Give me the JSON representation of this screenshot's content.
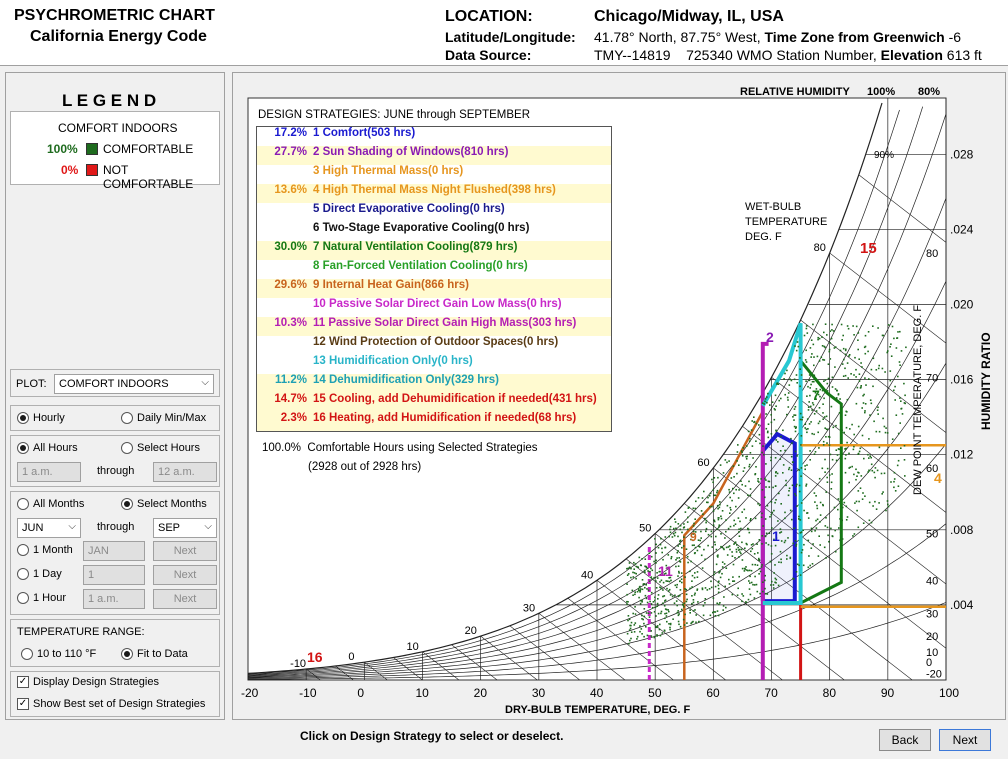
{
  "header": {
    "title_line1": "PSYCHROMETRIC CHART",
    "title_line2": "California Energy Code",
    "location_label": "LOCATION:",
    "location_value": "Chicago/Midway, IL, USA",
    "latlon_label": "Latitude/Longitude:",
    "latlon_value": "41.78° North, 87.75° West,",
    "timezone_label": "Time Zone from Greenwich",
    "timezone_value": "-6",
    "source_label": "Data Source:",
    "source_value": "TMY--14819",
    "wmo_value": "725340 WMO Station Number,",
    "elevation_label": "Elevation",
    "elevation_value": "613 ft"
  },
  "legend": {
    "title": "L E G E N D",
    "subtitle": "COMFORT INDOORS",
    "items": [
      {
        "pct": "100%",
        "label": "COMFORTABLE",
        "color": "#1e6b1e"
      },
      {
        "pct": "0%",
        "label": "NOT COMFORTABLE",
        "color": "#e01818"
      }
    ]
  },
  "controls": {
    "plot_label": "PLOT:",
    "plot_value": "COMFORT INDOORS",
    "hourly": "Hourly",
    "daily": "Daily Min/Max",
    "all_hours": "All Hours",
    "select_hours": "Select Hours",
    "hour_from": "1 a.m.",
    "through": "through",
    "hour_to": "12 a.m.",
    "all_months": "All Months",
    "select_months": "Select Months",
    "month_from": "JUN",
    "month_to": "SEP",
    "one_month": "1 Month",
    "one_month_val": "JAN",
    "one_day": "1 Day",
    "one_day_val": "1",
    "one_hour": "1 Hour",
    "one_hour_val": "1 a.m.",
    "next": "Next",
    "temp_range_label": "TEMPERATURE RANGE:",
    "range_a": "10 to 110 °F",
    "range_b": "Fit to Data",
    "display_strategies": "Display Design Strategies",
    "show_best": "Show Best set of Design Strategies"
  },
  "strategies": {
    "title": "DESIGN STRATEGIES:  JUNE through SEPTEMBER",
    "items": [
      {
        "pct": "17.2%",
        "label": "1  Comfort(503 hrs)",
        "color": "#1a1ad0",
        "hl": false
      },
      {
        "pct": "27.7%",
        "label": "2  Sun Shading of Windows(810 hrs)",
        "color": "#8a1ab4",
        "hl": true
      },
      {
        "pct": "",
        "label": "3  High Thermal Mass(0 hrs)",
        "color": "#e6961e",
        "hl": false
      },
      {
        "pct": "13.6%",
        "label": "4  High Thermal Mass Night Flushed(398 hrs)",
        "color": "#e6961e",
        "hl": true
      },
      {
        "pct": "",
        "label": "5  Direct Evaporative Cooling(0 hrs)",
        "color": "#1a1a8c",
        "hl": false
      },
      {
        "pct": "",
        "label": "6  Two-Stage Evaporative Cooling(0 hrs)",
        "color": "#111111",
        "hl": false
      },
      {
        "pct": "30.0%",
        "label": "7  Natural Ventilation Cooling(879 hrs)",
        "color": "#147814",
        "hl": true
      },
      {
        "pct": "",
        "label": "8  Fan-Forced Ventilation Cooling(0 hrs)",
        "color": "#28a028",
        "hl": false
      },
      {
        "pct": "29.6%",
        "label": "9  Internal Heat Gain(866 hrs)",
        "color": "#c8641e",
        "hl": true
      },
      {
        "pct": "",
        "label": "10  Passive Solar Direct Gain Low Mass(0 hrs)",
        "color": "#c828c8",
        "hl": false
      },
      {
        "pct": "10.3%",
        "label": "11  Passive Solar Direct Gain High Mass(303 hrs)",
        "color": "#b41eb4",
        "hl": true
      },
      {
        "pct": "",
        "label": "12  Wind Protection of Outdoor Spaces(0 hrs)",
        "color": "#5a3c14",
        "hl": false
      },
      {
        "pct": "",
        "label": "13  Humidification Only(0 hrs)",
        "color": "#28b4c8",
        "hl": false
      },
      {
        "pct": "11.2%",
        "label": "14  Dehumidification Only(329 hrs)",
        "color": "#1ea0b4",
        "hl": true
      },
      {
        "pct": "14.7%",
        "label": "15  Cooling, add Dehumidification if needed(431 hrs)",
        "color": "#d21414",
        "hl": true
      },
      {
        "pct": "2.3%",
        "label": "16  Heating, add Humidification if needed(68 hrs)",
        "color": "#d21414",
        "hl": true
      }
    ],
    "summary_pct": "100.0%",
    "summary_text": "Comfortable Hours using Selected Strategies",
    "summary_sub": "(2928 out of 2928 hrs)"
  },
  "chart": {
    "rh_label": "RELATIVE HUMIDITY",
    "rh_100": "100%",
    "rh_80": "80%",
    "rh_90": "90%",
    "wb_label1": "WET-BULB",
    "wb_label2": "TEMPERATURE",
    "wb_label3": "DEG. F",
    "xlabel": "DRY-BULB TEMPERATURE, DEG. F",
    "ylabel_dp": "DEW POINT TEMPERATURE, DEG. F",
    "ylabel_hr": "HUMIDITY RATIO",
    "x_ticks": [
      "-20",
      "-10",
      "0",
      "10",
      "20",
      "30",
      "40",
      "50",
      "60",
      "70",
      "80",
      "90",
      "100"
    ],
    "hr_ticks": [
      ".028",
      ".024",
      ".020",
      ".016",
      ".012",
      ".008",
      ".004"
    ],
    "dp_ticks": [
      "80",
      "70",
      "60",
      "50",
      "40",
      "30",
      "20",
      "10",
      "0",
      "-20"
    ],
    "wb_ticks": [
      "80",
      "60",
      "50",
      "40",
      "30",
      "20",
      "10",
      "0",
      "-10"
    ],
    "zone_labels": [
      "15",
      "16",
      "2",
      "7",
      "4",
      "9",
      "11",
      "1"
    ]
  },
  "footer": {
    "hint": "Click on Design Strategy to select or deselect.",
    "back": "Back",
    "next": "Next"
  }
}
